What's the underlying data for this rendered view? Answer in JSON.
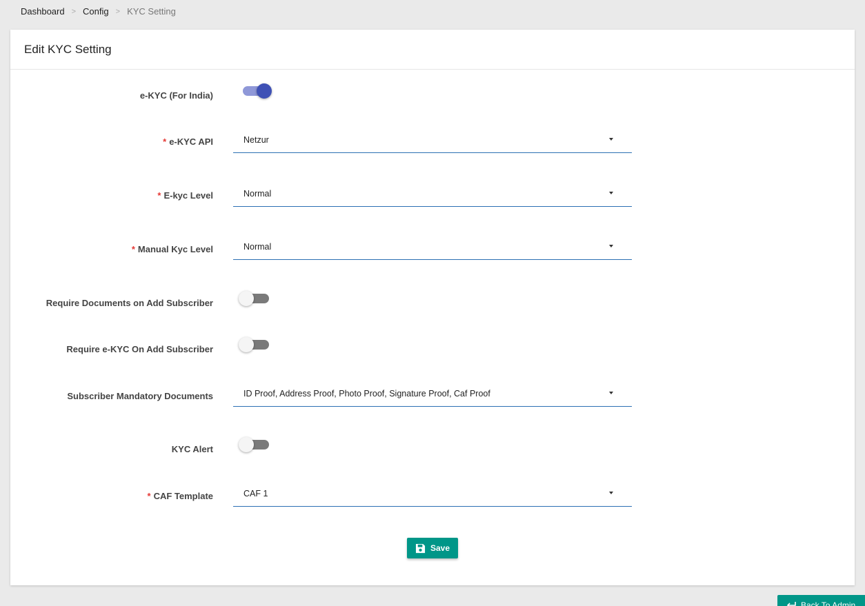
{
  "breadcrumb": {
    "items": [
      "Dashboard",
      "Config",
      "KYC Setting"
    ],
    "separator": ">"
  },
  "card": {
    "title": "Edit KYC Setting"
  },
  "form": {
    "ekyc_india": {
      "label": "e-KYC (For India)",
      "enabled": true
    },
    "ekyc_api": {
      "label": "e-KYC API",
      "required_mark": "*",
      "value": "Netzur"
    },
    "ekyc_level": {
      "label": "E-kyc Level",
      "required_mark": "*",
      "value": "Normal"
    },
    "manual_kyc_level": {
      "label": "Manual Kyc Level",
      "required_mark": "*",
      "value": "Normal"
    },
    "require_docs_add_subscriber": {
      "label": "Require Documents on Add Subscriber",
      "enabled": false
    },
    "require_ekyc_add_subscriber": {
      "label": "Require e-KYC On Add Subscriber",
      "enabled": false
    },
    "subscriber_mandatory_docs": {
      "label": "Subscriber Mandatory Documents",
      "value": "ID Proof, Address Proof, Photo Proof, Signature Proof, Caf Proof"
    },
    "kyc_alert": {
      "label": "KYC Alert",
      "enabled": false
    },
    "caf_template": {
      "label": "CAF Template",
      "required_mark": "*",
      "value": "CAF 1"
    }
  },
  "actions": {
    "save_label": "Save",
    "back_label": "Back To Admin"
  },
  "colors": {
    "primary_button": "#009688",
    "toggle_on": "#3f51b5",
    "select_underline": "#2a6fb3",
    "required": "#e53935"
  },
  "icons": [
    "save-icon",
    "back-arrow-icon",
    "dropdown-caret-icon"
  ]
}
